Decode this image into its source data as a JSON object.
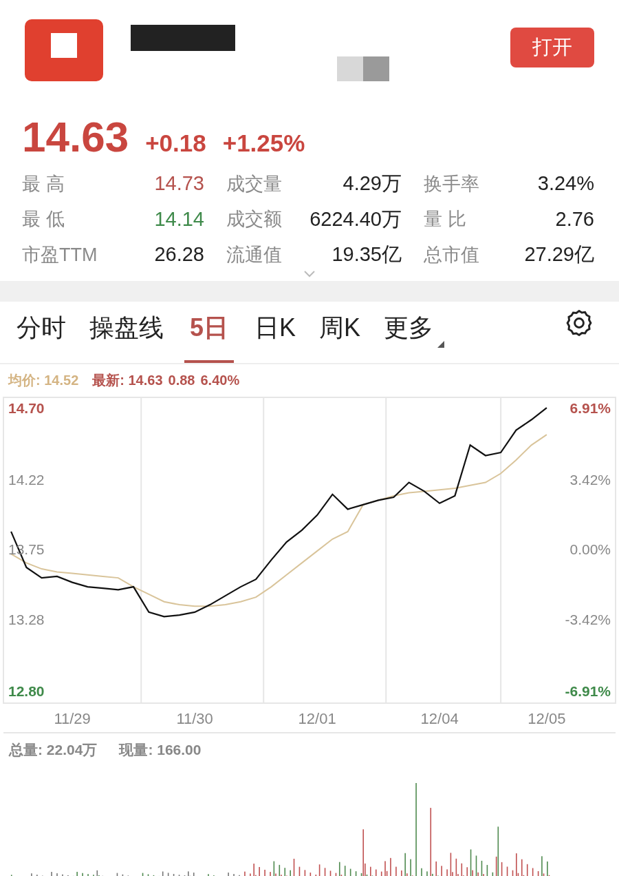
{
  "header": {
    "open_button": "打开"
  },
  "quote": {
    "price": "14.63",
    "change": "+0.18",
    "change_pct": "+1.25%"
  },
  "stats": [
    {
      "label": "最 高",
      "value": "14.73",
      "color": "#b5524d"
    },
    {
      "label": "成交量",
      "value": "4.29万",
      "color": "#222222"
    },
    {
      "label": "换手率",
      "value": "3.24%",
      "color": "#222222"
    },
    {
      "label": "最 低",
      "value": "14.14",
      "color": "#3f8a4a"
    },
    {
      "label": "成交额",
      "value": "6224.40万",
      "color": "#222222"
    },
    {
      "label": "量 比",
      "value": "2.76",
      "color": "#222222"
    },
    {
      "label": "市盈TTM",
      "value": "26.28",
      "color": "#222222"
    },
    {
      "label": "流通值",
      "value": "19.35亿",
      "color": "#222222"
    },
    {
      "label": "总市值",
      "value": "27.29亿",
      "color": "#222222"
    }
  ],
  "tabs": [
    {
      "label": "分时",
      "selected": false
    },
    {
      "label": "操盘线",
      "selected": false
    },
    {
      "label": "5日",
      "selected": true
    },
    {
      "label": "日K",
      "selected": false
    },
    {
      "label": "周K",
      "selected": false
    },
    {
      "label": "更多",
      "selected": false
    }
  ],
  "legend": {
    "average": "均价: 14.52",
    "latest": "最新: 14.63",
    "change": "0.88",
    "change_pct": "6.40%"
  },
  "price_chart": {
    "right_labels": [
      {
        "text": "6.91%",
        "color": "#b5524d"
      },
      {
        "text": "3.42%",
        "color": "#888888"
      },
      {
        "text": "0.00%",
        "color": "#888888"
      },
      {
        "text": "-3.42%",
        "color": "#888888"
      },
      {
        "text": "-6.91%",
        "color": "#3f8a4a"
      }
    ],
    "chart_data": {
      "type": "line",
      "categories": [
        null,
        null,
        null,
        null,
        "11/29",
        null,
        null,
        null,
        null,
        null,
        null,
        null,
        "11/30",
        null,
        null,
        null,
        null,
        null,
        null,
        null,
        "12/01",
        null,
        null,
        null,
        null,
        null,
        null,
        null,
        "12/04",
        null,
        null,
        null,
        null,
        null,
        null,
        "12/05",
        null,
        null,
        null,
        null
      ],
      "series": [
        {
          "color": "#111111",
          "values": [
            13.87,
            13.63,
            13.56,
            13.57,
            13.53,
            13.5,
            13.49,
            13.48,
            13.5,
            13.33,
            13.3,
            13.31,
            13.33,
            13.38,
            13.44,
            13.5,
            13.55,
            13.68,
            13.8,
            13.88,
            13.98,
            14.12,
            14.02,
            14.05,
            14.08,
            14.1,
            14.2,
            14.14,
            14.06,
            14.11,
            14.45,
            14.38,
            14.4,
            14.55,
            14.62,
            14.7,
            null,
            null,
            null,
            null
          ]
        },
        {
          "color": "#d9c49a",
          "values": [
            13.72,
            13.66,
            13.62,
            13.6,
            13.59,
            13.58,
            13.57,
            13.56,
            13.5,
            13.45,
            13.4,
            13.38,
            13.37,
            13.37,
            13.38,
            13.4,
            13.43,
            13.5,
            13.58,
            13.66,
            13.74,
            13.82,
            13.87,
            14.05,
            14.08,
            14.11,
            14.13,
            14.14,
            14.15,
            14.16,
            14.18,
            14.2,
            14.26,
            14.35,
            14.45,
            14.52,
            null,
            null,
            null,
            null
          ]
        }
      ],
      "ylim": [
        12.72,
        14.77
      ],
      "yticks": [
        {
          "value": 14.7,
          "label": "14.70"
        },
        {
          "value": 14.22,
          "label": "14.22"
        },
        {
          "value": 13.75,
          "label": "13.75"
        },
        {
          "value": 13.28,
          "label": "13.28"
        },
        {
          "value": 12.8,
          "label": "12.80"
        }
      ]
    }
  },
  "volume": {
    "total": "总量: 22.04万",
    "current": "现量: 166.00"
  }
}
